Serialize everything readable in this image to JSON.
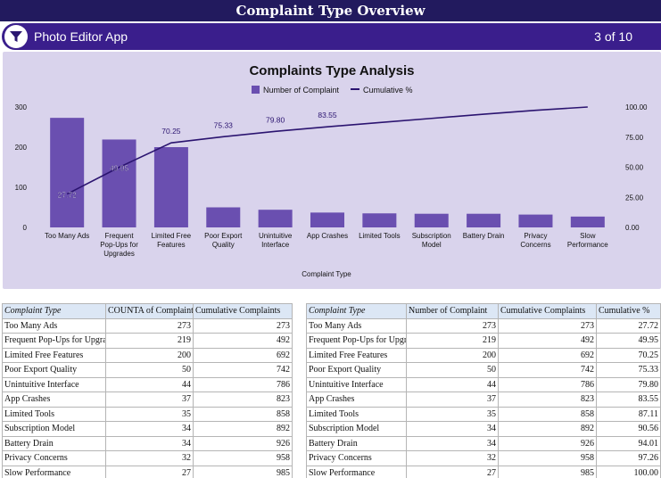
{
  "header": {
    "title": "Complaint Type Overview"
  },
  "app_bar": {
    "app_name": "Photo Editor App",
    "page_indicator": "3 of 10"
  },
  "chart_data": {
    "type": "bar",
    "title": "Complaints Type Analysis",
    "xlabel": "Complaint Type",
    "ylabel": "",
    "categories": [
      [
        "Too Many Ads"
      ],
      [
        "Frequent",
        "Pop-Ups for",
        "Upgrades"
      ],
      [
        "Limited Free",
        "Features"
      ],
      [
        "Poor Export",
        "Quality"
      ],
      [
        "Unintuitive",
        "Interface"
      ],
      [
        "App Crashes"
      ],
      [
        "Limited Tools"
      ],
      [
        "Subscription",
        "Model"
      ],
      [
        "Battery Drain"
      ],
      [
        "Privacy",
        "Concerns"
      ],
      [
        "Slow",
        "Performance"
      ]
    ],
    "series": [
      {
        "name": "Number of Complaint",
        "kind": "bar",
        "axis": "left",
        "color": "#6a4fb0",
        "values": [
          273,
          219,
          200,
          50,
          44,
          37,
          35,
          34,
          34,
          32,
          27
        ]
      },
      {
        "name": "Cumulative %",
        "kind": "line",
        "axis": "right",
        "color": "#2b1470",
        "values": [
          27.72,
          49.95,
          70.25,
          75.33,
          79.8,
          83.55,
          87.11,
          90.56,
          94.01,
          97.26,
          100.0
        ],
        "labels": [
          "27.72",
          "49.95",
          "70.25",
          "75.33",
          "79.80",
          "83.55"
        ]
      }
    ],
    "y_left": {
      "ylim": [
        0,
        300
      ],
      "ticks": [
        "0",
        "100",
        "200",
        "300"
      ]
    },
    "y_right": {
      "ylim": [
        0,
        100
      ],
      "ticks": [
        "0.00",
        "25.00",
        "50.00",
        "75.00",
        "100.00"
      ]
    },
    "legend_position": "top-center",
    "grid": false
  },
  "table_left": {
    "headers": [
      "Complaint Type",
      "COUNTA of Complaint",
      "Cumulative Complaints"
    ],
    "rows": [
      [
        "Too Many Ads",
        "273",
        "273"
      ],
      [
        "Frequent Pop-Ups for Upgrades",
        "219",
        "492"
      ],
      [
        "Limited Free Features",
        "200",
        "692"
      ],
      [
        "Poor Export Quality",
        "50",
        "742"
      ],
      [
        "Unintuitive Interface",
        "44",
        "786"
      ],
      [
        "App Crashes",
        "37",
        "823"
      ],
      [
        "Limited Tools",
        "35",
        "858"
      ],
      [
        "Subscription Model",
        "34",
        "892"
      ],
      [
        "Battery Drain",
        "34",
        "926"
      ],
      [
        "Privacy Concerns",
        "32",
        "958"
      ],
      [
        "Slow Performance",
        "27",
        "985"
      ]
    ]
  },
  "table_right": {
    "headers": [
      "Complaint Type",
      "Number of Complaint",
      "Cumulative Complaints",
      "Cumulative %"
    ],
    "rows": [
      [
        "Too Many Ads",
        "273",
        "273",
        "27.72"
      ],
      [
        "Frequent Pop-Ups for Upgrades",
        "219",
        "492",
        "49.95"
      ],
      [
        "Limited Free Features",
        "200",
        "692",
        "70.25"
      ],
      [
        "Poor Export Quality",
        "50",
        "742",
        "75.33"
      ],
      [
        "Unintuitive Interface",
        "44",
        "786",
        "79.80"
      ],
      [
        "App Crashes",
        "37",
        "823",
        "83.55"
      ],
      [
        "Limited Tools",
        "35",
        "858",
        "87.11"
      ],
      [
        "Subscription Model",
        "34",
        "892",
        "90.56"
      ],
      [
        "Battery Drain",
        "34",
        "926",
        "94.01"
      ],
      [
        "Privacy Concerns",
        "32",
        "958",
        "97.26"
      ],
      [
        "Slow Performance",
        "27",
        "985",
        "100.00"
      ]
    ]
  }
}
